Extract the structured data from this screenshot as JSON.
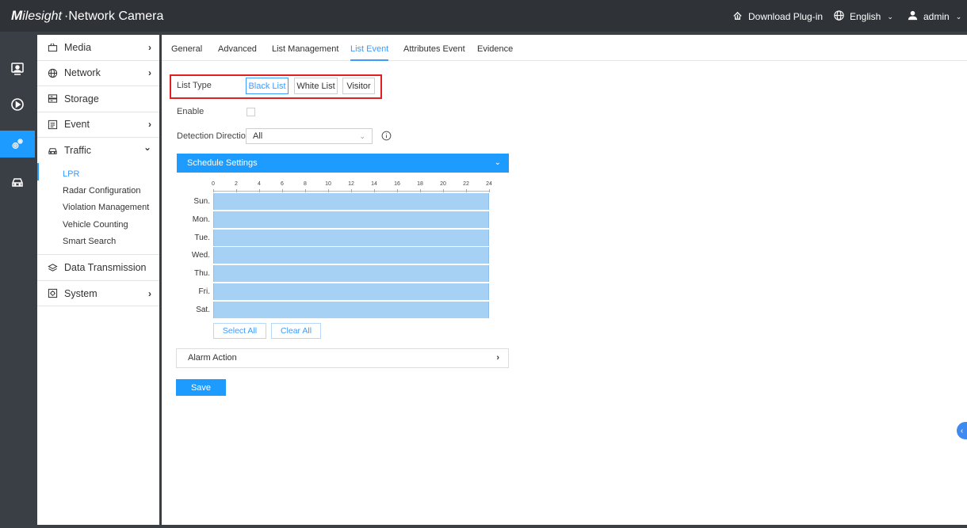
{
  "app": {
    "brand_m": "M",
    "brand_rest": "ilesight",
    "product": "·Network Camera"
  },
  "topbar": {
    "download_label": "Download Plug-in",
    "language_label": "English",
    "user_label": "admin"
  },
  "rail": {
    "items": [
      {
        "icon": "live-view-icon"
      },
      {
        "icon": "playback-icon"
      },
      {
        "icon": "settings-icon",
        "active": true
      },
      {
        "icon": "vehicle-icon"
      }
    ]
  },
  "sidemenu": {
    "items": [
      {
        "label": "Media",
        "icon": "media-icon",
        "arrow": "›"
      },
      {
        "label": "Network",
        "icon": "globe-icon",
        "arrow": "›"
      },
      {
        "label": "Storage",
        "icon": "storage-icon",
        "arrow": ""
      },
      {
        "label": "Event",
        "icon": "event-icon",
        "arrow": "›"
      },
      {
        "label": "Traffic",
        "icon": "car-icon",
        "arrow": "⌄"
      }
    ],
    "traffic_sub": [
      {
        "label": "LPR",
        "active": true
      },
      {
        "label": "Radar Configuration"
      },
      {
        "label": "Violation Management"
      },
      {
        "label": "Vehicle Counting"
      },
      {
        "label": "Smart Search"
      }
    ],
    "items_after": [
      {
        "label": "Data Transmission",
        "icon": "layers-icon",
        "arrow": ""
      },
      {
        "label": "System",
        "icon": "system-icon",
        "arrow": "›"
      }
    ]
  },
  "tabs": [
    {
      "label": "General"
    },
    {
      "label": "Advanced"
    },
    {
      "label": "List Management"
    },
    {
      "label": "List Event",
      "active": true
    },
    {
      "label": "Attributes Event"
    },
    {
      "label": "Evidence"
    }
  ],
  "form": {
    "list_type_label": "List Type",
    "list_type_options": [
      "Black List",
      "White List",
      "Visitor"
    ],
    "list_type_selected": "Black List",
    "enable_label": "Enable",
    "enable_checked": false,
    "direction_label": "Detection Direction",
    "direction_value": "All"
  },
  "schedule": {
    "header": "Schedule Settings",
    "hours": [
      "0",
      "2",
      "4",
      "6",
      "8",
      "10",
      "12",
      "14",
      "16",
      "18",
      "20",
      "22",
      "24"
    ],
    "days": [
      "Sun.",
      "Mon.",
      "Tue.",
      "Wed.",
      "Thu.",
      "Fri.",
      "Sat."
    ],
    "select_all_label": "Select All",
    "clear_all_label": "Clear All"
  },
  "alarm": {
    "label": "Alarm Action",
    "arrow": "›"
  },
  "save_label": "Save",
  "colors": {
    "accent": "#1e9bff",
    "schedule_fill": "#a6d1f5",
    "highlight_box": "#e02020"
  }
}
